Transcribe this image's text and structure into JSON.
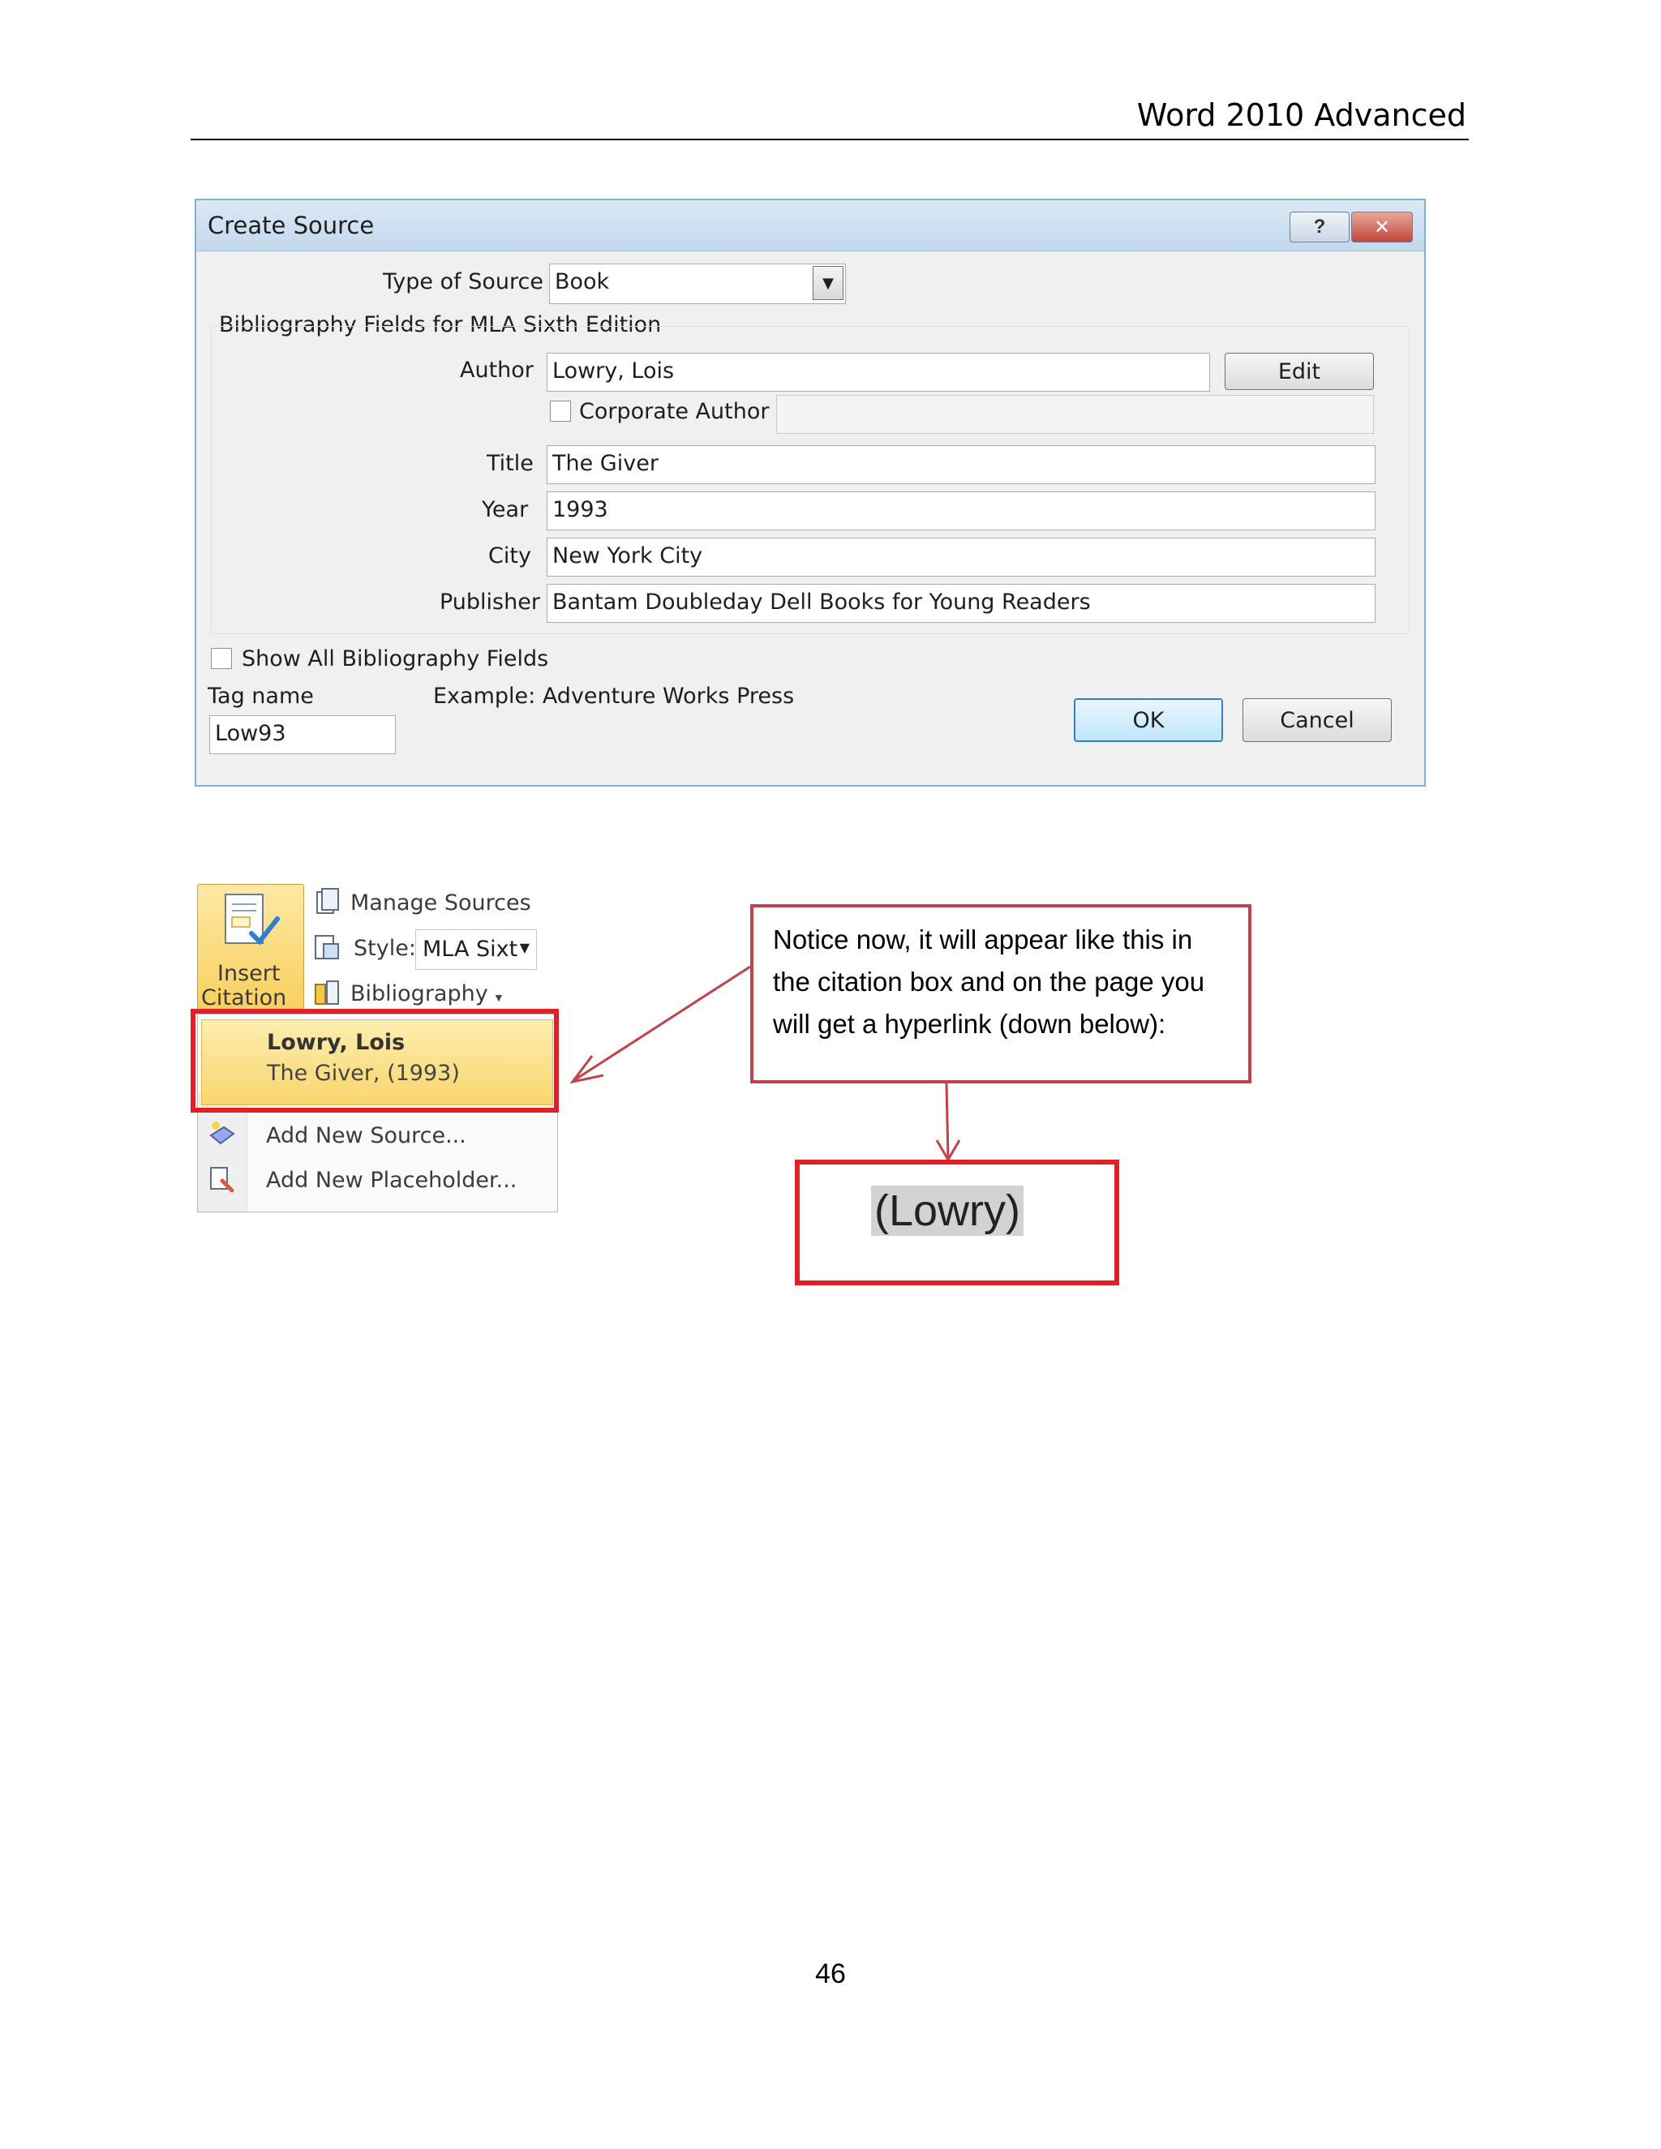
{
  "header": {
    "title": "Word 2010 Advanced"
  },
  "dialog": {
    "title": "Create Source",
    "help_glyph": "?",
    "close_glyph": "✕",
    "type_of_source_label": "Type of Source",
    "type_of_source_value": "Book",
    "group_label": "Bibliography Fields for MLA Sixth Edition",
    "author_label": "Author",
    "author_value": "Lowry, Lois",
    "edit_button": "Edit",
    "corporate_author_label": "Corporate Author",
    "title_label": "Title",
    "title_value": "The Giver",
    "year_label": "Year",
    "year_value": "1993",
    "city_label": "City",
    "city_value": "New York City",
    "publisher_label": "Publisher",
    "publisher_value": "Bantam Doubleday Dell Books for Young Readers",
    "show_all_label": "Show All Bibliography Fields",
    "tag_name_label": "Tag name",
    "example_text": "Example: Adventure Works Press",
    "tag_name_value": "Low93",
    "ok_button": "OK",
    "cancel_button": "Cancel"
  },
  "ribbon": {
    "insert_citation_line1": "Insert",
    "insert_citation_line2": "Citation",
    "manage_sources": "Manage Sources",
    "style_label": "Style:",
    "style_value": "MLA Sixt",
    "bibliography": "Bibliography",
    "citation_author": "Lowry, Lois",
    "citation_detail": "The Giver, (1993)",
    "add_new_source": "Add New Source...",
    "add_new_placeholder": "Add New Placeholder..."
  },
  "callout": {
    "text": "Notice now, it will appear like this in the citation box and on the page you will get a hyperlink (down below):"
  },
  "citation_example": {
    "text": "(Lowry)"
  },
  "page_number": "46",
  "colors": {
    "highlight_red": "#e11f26",
    "callout_border": "#c0424a",
    "ribbon_gold": "#f8cf5b"
  }
}
